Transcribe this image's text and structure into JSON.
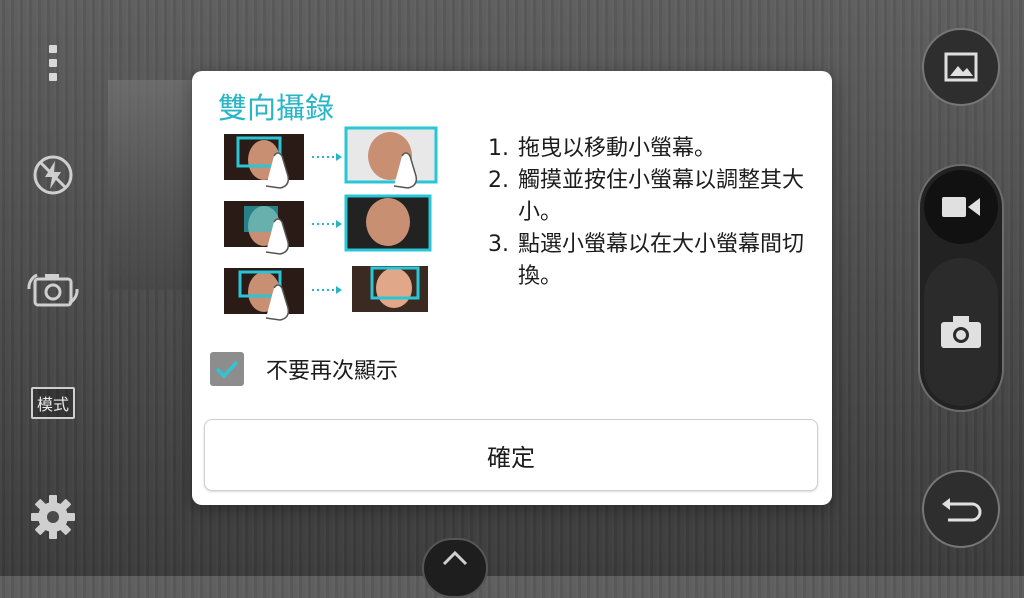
{
  "left_bar": {
    "menu_icon": "more-vert-icon",
    "flash_icon": "flash-off-icon",
    "switch_icon": "switch-camera-icon",
    "mode_label": "模式",
    "settings_icon": "gear-icon"
  },
  "right_bar": {
    "gallery_icon": "gallery-icon",
    "video_icon": "video-icon",
    "shutter_icon": "camera-icon",
    "back_icon": "back-icon"
  },
  "bottom": {
    "expand_icon": "chevron-up-icon"
  },
  "dialog": {
    "title": "雙向攝錄",
    "accent_color": "#28b6c6",
    "instructions": [
      {
        "num": "1.",
        "text": "拖曳以移動小螢幕。"
      },
      {
        "num": "2.",
        "text": "觸摸並按住小螢幕以調整其大小。"
      },
      {
        "num": "3.",
        "text": "點選小螢幕以在大小螢幕間切換。"
      }
    ],
    "checkbox": {
      "label": "不要再次顯示",
      "checked": true
    },
    "ok_label": "確定"
  }
}
